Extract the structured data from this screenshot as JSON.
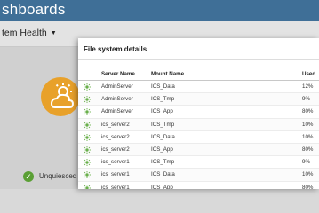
{
  "app": {
    "title": "shboards",
    "system_health_label": "tem Health",
    "status_text": "Unquiesced s"
  },
  "dialog": {
    "title": "File system details",
    "columns": [
      "Server Name",
      "Mount Name",
      "Used"
    ],
    "rows": [
      {
        "server": "AdminServer",
        "mount": "ICS_Data",
        "used": "12%"
      },
      {
        "server": "AdminServer",
        "mount": "ICS_Tmp",
        "used": "9%"
      },
      {
        "server": "AdminServer",
        "mount": "ICS_App",
        "used": "80%"
      },
      {
        "server": "ics_server2",
        "mount": "ICS_Tmp",
        "used": "10%"
      },
      {
        "server": "ics_server2",
        "mount": "ICS_Data",
        "used": "10%"
      },
      {
        "server": "ics_server2",
        "mount": "ICS_App",
        "used": "80%"
      },
      {
        "server": "ics_server1",
        "mount": "ICS_Tmp",
        "used": "9%"
      },
      {
        "server": "ics_server1",
        "mount": "ICS_Data",
        "used": "10%"
      },
      {
        "server": "ics_server1",
        "mount": "ICS_App",
        "used": "80%"
      }
    ]
  },
  "colors": {
    "header": "#3f6f97",
    "status_ok": "#5a9f34",
    "weather": "#e8a12a"
  },
  "icons": {
    "row_status": "sun-status-icon",
    "weather": "cloud-sun-icon",
    "status": "check-circle-icon",
    "dropdown": "chevron-down-icon"
  }
}
